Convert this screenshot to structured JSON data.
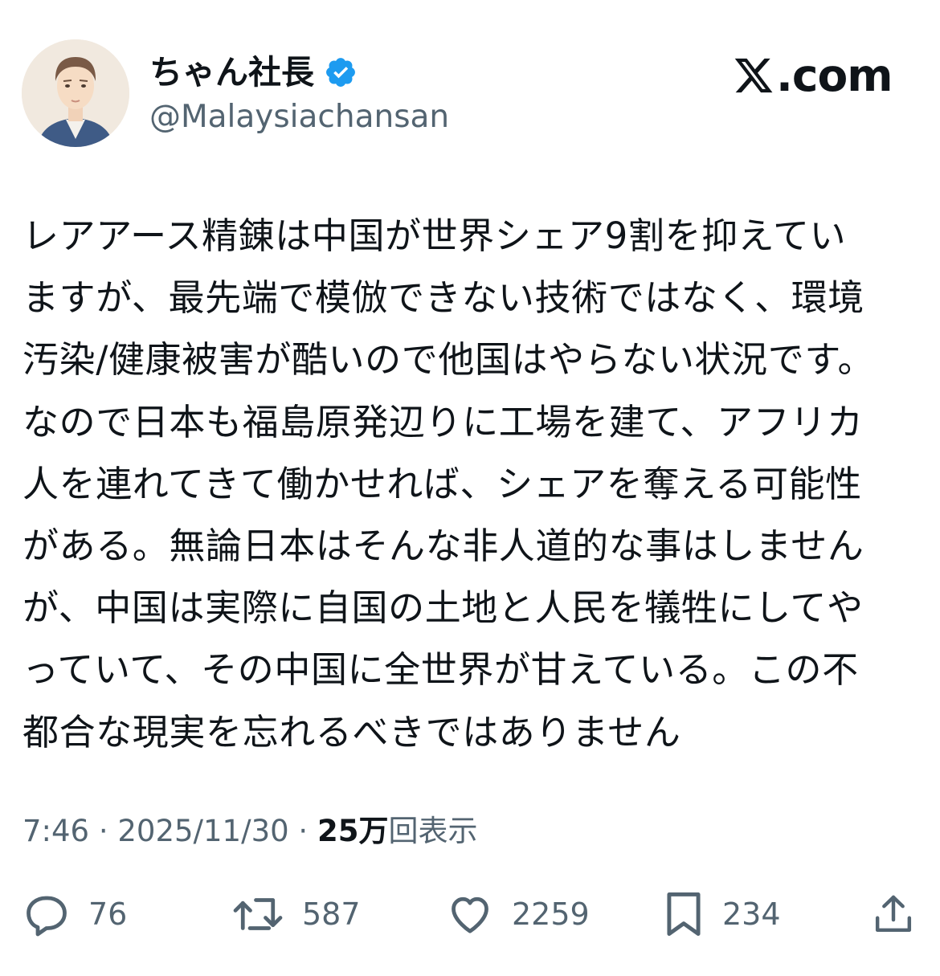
{
  "author": {
    "display_name": "ちゃん社長",
    "handle": "@Malaysiachansan",
    "verified_badge": "verified-badge-icon",
    "avatar": "avatar-illustration"
  },
  "brand": {
    "logo_icon": "x-logo-icon",
    "text": ".com"
  },
  "post": {
    "lines": [
      "レアアース精錬は中国が世界シェア9割を抑えてい",
      "ますが、最先端で模倣できない技術ではなく、環境",
      "汚染/健康被害が酷いので他国はやらない状況です。",
      "なので日本も福島原発辺りに工場を建て、アフリカ",
      "人を連れてきて働かせれば、シェアを奪える可能性",
      "がある。無論日本はそんな非人道的な事はしません",
      "が、中国は実際に自国の土地と人民を犠牲にしてや",
      "っていて、その中国に全世界が甘えている。この不",
      "都合な現実を忘れるべきではありません"
    ]
  },
  "meta": {
    "time": "7:46",
    "separator": "·",
    "date": "2025/11/30",
    "views_count": "25万",
    "views_label": "回表示"
  },
  "actions": {
    "replies": {
      "icon": "reply-icon",
      "count": "76"
    },
    "reposts": {
      "icon": "repost-icon",
      "count": "587"
    },
    "likes": {
      "icon": "like-icon",
      "count": "2259"
    },
    "bookmarks": {
      "icon": "bookmark-icon",
      "count": "234"
    },
    "share": {
      "icon": "share-icon"
    }
  },
  "colors": {
    "text_primary": "#0f1419",
    "text_secondary": "#536471",
    "verified_blue": "#1d9bf0",
    "background": "#ffffff"
  }
}
